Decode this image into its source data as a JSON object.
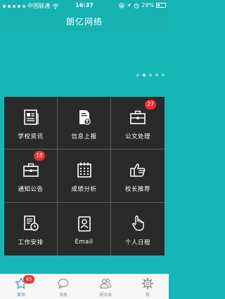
{
  "status": {
    "carrier": "中国联通",
    "time": "16:37",
    "battery": "29%",
    "battery_level": 0.29
  },
  "nav": {
    "title": "朗亿网络"
  },
  "carousel": {
    "pages": 5,
    "active_index": 1
  },
  "grid": {
    "items": [
      {
        "label": "学校资讯",
        "icon": "newspaper-icon",
        "badge": ""
      },
      {
        "label": "信息上报",
        "icon": "upload-document-icon",
        "badge": ""
      },
      {
        "label": "公文处理",
        "icon": "briefcase-icon",
        "badge": "27"
      },
      {
        "label": "通知公告",
        "icon": "briefcase-icon",
        "badge": "18"
      },
      {
        "label": "成绩分析",
        "icon": "calendar-icon",
        "badge": ""
      },
      {
        "label": "校长推荐",
        "icon": "thumbs-up-icon",
        "badge": ""
      },
      {
        "label": "工作安排",
        "icon": "schedule-clock-icon",
        "badge": ""
      },
      {
        "label": "Email",
        "icon": "contact-card-icon",
        "badge": ""
      },
      {
        "label": "个人日程",
        "icon": "tap-hand-icon",
        "badge": ""
      }
    ]
  },
  "tabbar": {
    "tabs": [
      {
        "label": "首页",
        "icon": "star-icon",
        "badge": "45",
        "active": true
      },
      {
        "label": "消息",
        "icon": "chat-bubble-icon",
        "badge": "",
        "active": false
      },
      {
        "label": "通讯录",
        "icon": "contacts-icon",
        "badge": "",
        "active": false
      },
      {
        "label": "我",
        "icon": "gear-icon",
        "badge": "",
        "active": false
      }
    ]
  },
  "colors": {
    "accent": "#16b6b6",
    "grid_background": "#2a2a2a",
    "badge": "#e8322e",
    "tab_active": "#2a93d5"
  }
}
